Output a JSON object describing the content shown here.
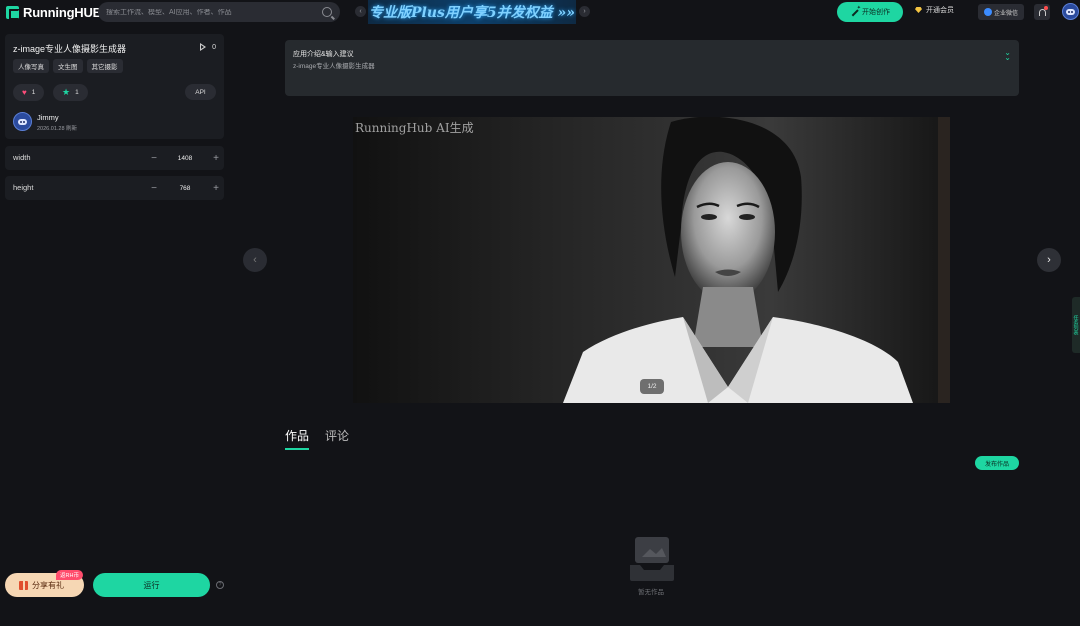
{
  "header": {
    "logo_text": "RunningHUB",
    "search_placeholder": "搜索工作流、模型、AI应用、作者、作品",
    "banner_text": "专业版Plus用户享5并发权益 »»",
    "start_button": "开始创作",
    "vip_button": "开通会员",
    "enterprise_button": "企业微信"
  },
  "app": {
    "title": "z-image专业人像摄影生成器",
    "play_count": "0",
    "tags": [
      "人像写真",
      "文生图",
      "其它摄影"
    ],
    "likes": "1",
    "favorites": "1",
    "api_label": "API",
    "author_name": "Jimmy",
    "author_date": "2026.01.28 刷新"
  },
  "params": {
    "width_label": "width",
    "width_value": "1408",
    "height_label": "height",
    "height_value": "768"
  },
  "footer": {
    "share_label": "分享有礼",
    "share_badge": "返RH币",
    "run_label": "运行"
  },
  "main": {
    "intro_title": "应用介绍&输入建议",
    "intro_text": "z-image专业人像摄影生成器",
    "watermark": "RunningHub AI生成",
    "pager": "1/2",
    "tab_works": "作品",
    "tab_comments": "评论",
    "publish_button": "发布作品",
    "empty_text": "暂无作品",
    "side_tab": "任务列表"
  },
  "colors": {
    "accent": "#1ed6a2",
    "background": "#121317",
    "panel": "#1b1d22"
  }
}
